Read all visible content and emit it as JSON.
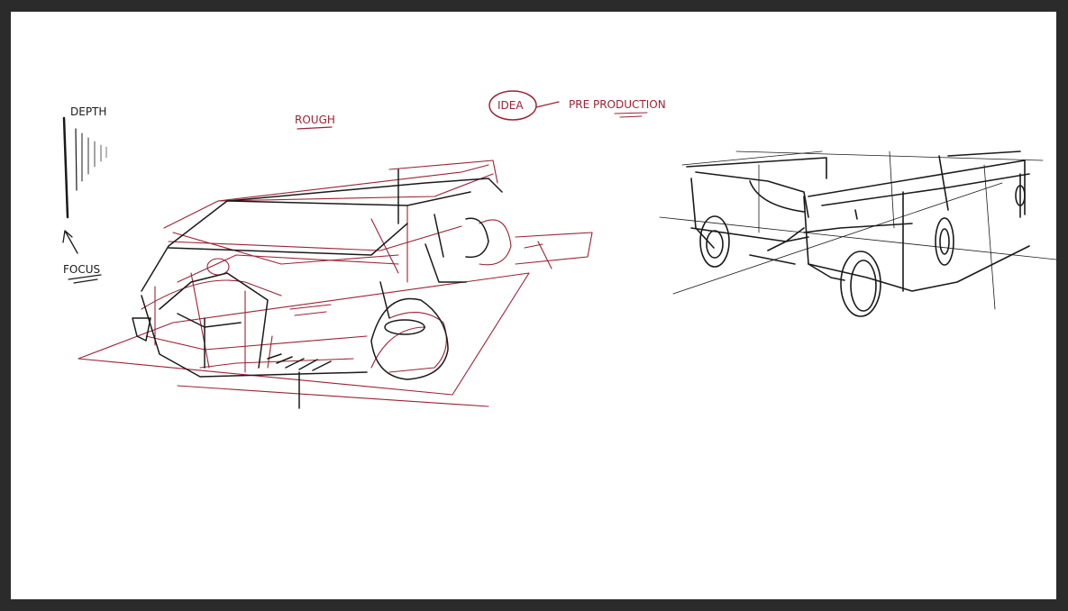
{
  "labels": {
    "depth": "DEPTH",
    "focus": "FOCUS",
    "rough": "ROUGH",
    "idea": "IDEA",
    "preproduction": "PRE PRODUCTION"
  },
  "colors": {
    "frame": "#2b2b2b",
    "canvas": "#ffffff",
    "ink_black": "#1a1a1a",
    "ink_red": "#9b2335"
  },
  "sketches": [
    "rough-car-sketch",
    "pickup-truck-sketch"
  ]
}
